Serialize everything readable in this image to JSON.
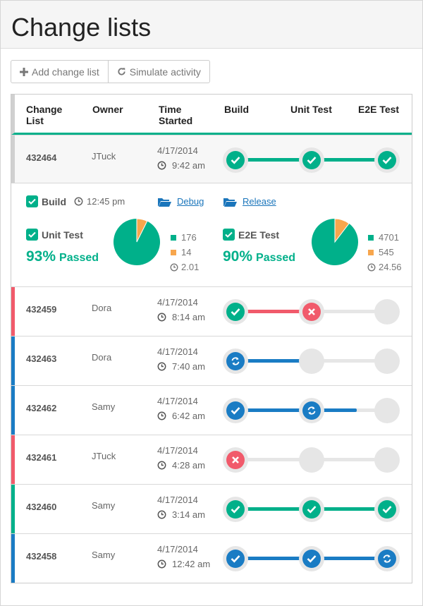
{
  "page": {
    "title": "Change lists"
  },
  "toolbar": {
    "add_label": "Add change list",
    "simulate_label": "Simulate activity"
  },
  "columns": {
    "change_list": "Change\nList",
    "owner": "Owner",
    "time_started": "Time\nStarted",
    "build": "Build",
    "unit_test": "Unit Test",
    "e2e_test": "E2E Test"
  },
  "colors": {
    "green": "#00b08a",
    "red": "#f15a6b",
    "blue": "#1a7cc4",
    "grey": "#e6e6e6",
    "orange": "#f7a64d"
  },
  "rows": [
    {
      "id": "432464",
      "owner": "JTuck",
      "date": "4/17/2014",
      "time": "9:42 am",
      "status_color": "#d0d0d0",
      "build": "pass",
      "unit": "pass",
      "e2e": "pass",
      "progress": 1.0,
      "fill_color": "#00b08a"
    },
    {
      "id": "432459",
      "owner": "Dora",
      "date": "4/17/2014",
      "time": "8:14 am",
      "status_color": "#f15a6b",
      "build": "pass",
      "unit": "fail",
      "e2e": "none",
      "progress": 0.5,
      "fill_color": "#f15a6b"
    },
    {
      "id": "432463",
      "owner": "Dora",
      "date": "4/17/2014",
      "time": "7:40 am",
      "status_color": "#1a7cc4",
      "build": "running",
      "unit": "none",
      "e2e": "none",
      "progress": 0.45,
      "fill_color": "#1a7cc4"
    },
    {
      "id": "432462",
      "owner": "Samy",
      "date": "4/17/2014",
      "time": "6:42 am",
      "status_color": "#1a7cc4",
      "build": "done",
      "unit": "running",
      "e2e": "none",
      "progress": 0.8,
      "fill_color": "#1a7cc4"
    },
    {
      "id": "432461",
      "owner": "JTuck",
      "date": "4/17/2014",
      "time": "4:28 am",
      "status_color": "#f15a6b",
      "build": "fail",
      "unit": "none",
      "e2e": "none",
      "progress": 0,
      "fill_color": "#f15a6b"
    },
    {
      "id": "432460",
      "owner": "Samy",
      "date": "4/17/2014",
      "time": "3:14 am",
      "status_color": "#00b08a",
      "build": "pass",
      "unit": "pass",
      "e2e": "pass",
      "progress": 1.0,
      "fill_color": "#00b08a"
    },
    {
      "id": "432458",
      "owner": "Samy",
      "date": "4/17/2014",
      "time": "12:42 am",
      "status_color": "#1a7cc4",
      "build": "done",
      "unit": "done",
      "e2e": "running",
      "progress": 0.98,
      "fill_color": "#1a7cc4"
    }
  ],
  "detail": {
    "build_label": "Build",
    "build_time": "12:45 pm",
    "debug_label": "Debug",
    "release_label": "Release",
    "unit": {
      "label": "Unit Test",
      "pct": "93%",
      "passed_label": "Passed",
      "passed": "176",
      "failed": "14",
      "duration": "2.01",
      "pass_fraction": 0.926
    },
    "e2e": {
      "label": "E2E Test",
      "pct": "90%",
      "passed_label": "Passed",
      "passed": "4701",
      "failed": "545",
      "duration": "24.56",
      "pass_fraction": 0.896
    }
  }
}
